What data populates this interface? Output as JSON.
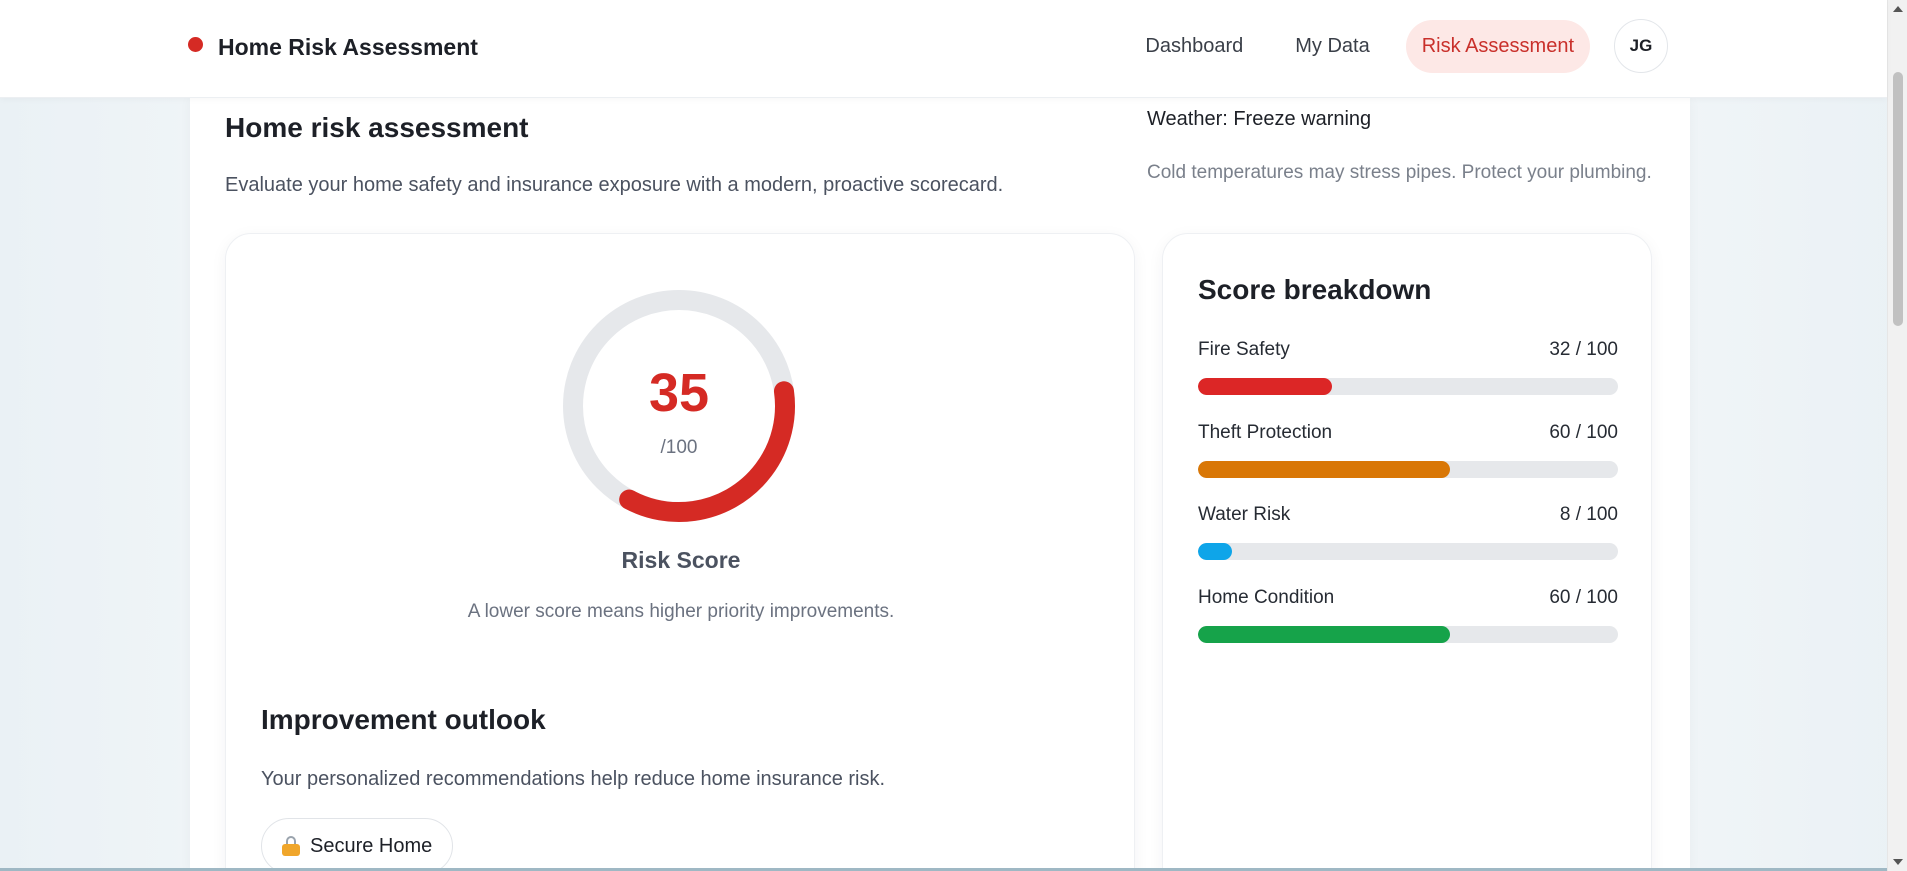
{
  "app": {
    "title": "Home Risk Assessment",
    "brand_color": "#d52a24"
  },
  "nav": {
    "items": [
      {
        "label": "Dashboard",
        "active": false
      },
      {
        "label": "My Data",
        "active": false
      },
      {
        "label": "Risk Assessment",
        "active": true
      }
    ],
    "avatar_initials": "JG"
  },
  "header": {
    "title": "Home risk assessment",
    "subtitle": "Evaluate your home safety and insurance exposure with a modern, proactive scorecard."
  },
  "weather": {
    "title": "Weather: Freeze warning",
    "description": "Cold temperatures may stress pipes. Protect your plumbing."
  },
  "score": {
    "value": "35",
    "max_label": "/100",
    "fraction": 0.35,
    "label": "Risk Score",
    "help": "A lower score means higher priority improvements.",
    "color": "#d52a24",
    "track_color": "#e6e8eb"
  },
  "outlook": {
    "title": "Improvement outlook",
    "subtitle": "Your personalized recommendations help reduce home insurance risk.",
    "chips": [
      {
        "label": "Secure Home",
        "icon": "lock-icon"
      }
    ]
  },
  "breakdown": {
    "title": "Score breakdown",
    "metrics": [
      {
        "label": "Fire Safety",
        "score": "32 / 100",
        "value": 32,
        "color": "#dc2626"
      },
      {
        "label": "Theft Protection",
        "score": "60 / 100",
        "value": 60,
        "color": "#d97706"
      },
      {
        "label": "Water Risk",
        "score": "8 / 100",
        "value": 8,
        "color": "#0ea5e9"
      },
      {
        "label": "Home Condition",
        "score": "60 / 100",
        "value": 60,
        "color": "#16a34a"
      }
    ]
  }
}
